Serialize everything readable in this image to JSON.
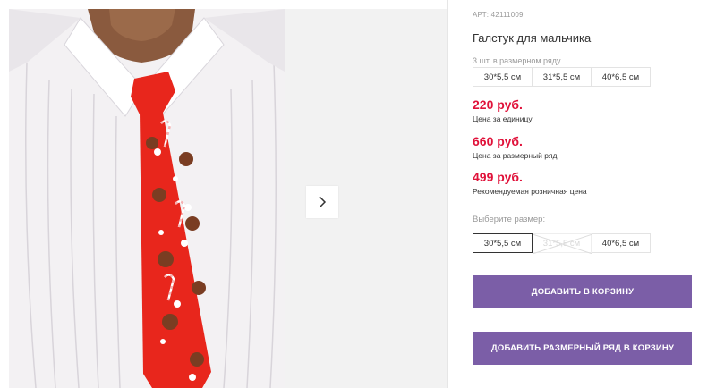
{
  "product": {
    "sku": "АРТ: 42111009",
    "title": "Галстук для мальчика",
    "set_label": "3 шт. в размерном ряду",
    "set_sizes": [
      "30*5,5 см",
      "31*5,5 см",
      "40*6,5 см"
    ],
    "prices": [
      {
        "value": "220 руб.",
        "label": "Цена за единицу"
      },
      {
        "value": "660 руб.",
        "label": "Цена за размерный ряд"
      },
      {
        "value": "499 руб.",
        "label": "Рекомендуемая розничная цена"
      }
    ],
    "choose_size_label": "Выберите размер:",
    "size_options": [
      {
        "label": "30*5,5 см",
        "state": "selected"
      },
      {
        "label": "31*5,5 см",
        "state": "unavailable"
      },
      {
        "label": "40*6,5 см",
        "state": "available"
      }
    ],
    "add_to_cart": "ДОБАВИТЬ В КОРЗИНУ",
    "add_set_to_cart": "ДОБАВИТЬ РАЗМЕРНЫЙ РЯД В КОРЗИНУ"
  },
  "colors": {
    "price": "#e0123a",
    "button": "#7b5ea7",
    "tie": "#e8261c"
  },
  "icons": {
    "gallery_next": "chevron-right-icon"
  }
}
